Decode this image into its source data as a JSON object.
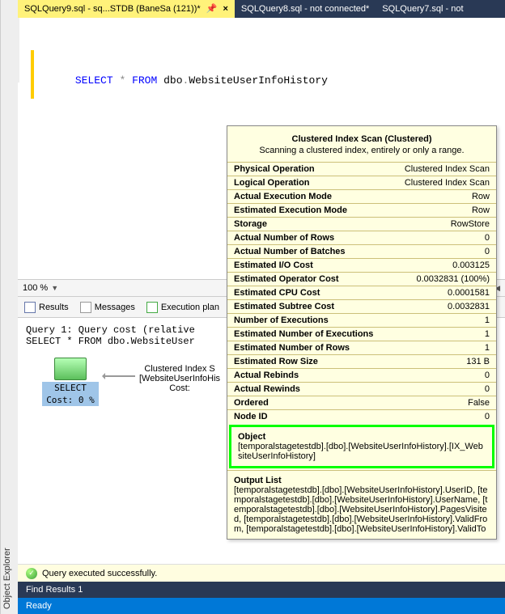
{
  "sidebar": {
    "label": "Object Explorer"
  },
  "tabs": [
    {
      "label": "SQLQuery9.sql - sq...STDB (BaneSa (121))*",
      "active": true,
      "pinned": true
    },
    {
      "label": "SQLQuery8.sql - not connected*",
      "active": false
    },
    {
      "label": "SQLQuery7.sql - not",
      "active": false
    }
  ],
  "editor": {
    "kw_select": "SELECT",
    "star": "*",
    "kw_from": "FROM",
    "schema": "dbo",
    "dot": ".",
    "table": "WebsiteUserInfoHistory"
  },
  "zoom": {
    "percent": "100 %"
  },
  "result_tabs": {
    "results": "Results",
    "messages": "Messages",
    "execplan": "Execution plan"
  },
  "query_lines": {
    "l1": "Query 1: Query cost (relative",
    "l2": "SELECT * FROM dbo.WebsiteUser"
  },
  "plan": {
    "select_label": "SELECT",
    "select_cost": "Cost: 0 %",
    "scan_l1": "Clustered Index S",
    "scan_l2": "[WebsiteUserInfoHis",
    "scan_l3": "Cost:"
  },
  "status": {
    "text": "Query executed successfully."
  },
  "find": {
    "label": "Find Results 1"
  },
  "ready": {
    "label": "Ready"
  },
  "tooltip": {
    "title": "Clustered Index Scan (Clustered)",
    "subtitle": "Scanning a clustered index, entirely or only a range.",
    "rows": [
      {
        "k": "Physical Operation",
        "v": "Clustered Index Scan"
      },
      {
        "k": "Logical Operation",
        "v": "Clustered Index Scan"
      },
      {
        "k": "Actual Execution Mode",
        "v": "Row"
      },
      {
        "k": "Estimated Execution Mode",
        "v": "Row"
      },
      {
        "k": "Storage",
        "v": "RowStore"
      },
      {
        "k": "Actual Number of Rows",
        "v": "0"
      },
      {
        "k": "Actual Number of Batches",
        "v": "0"
      },
      {
        "k": "Estimated I/O Cost",
        "v": "0.003125"
      },
      {
        "k": "Estimated Operator Cost",
        "v": "0.0032831 (100%)"
      },
      {
        "k": "Estimated CPU Cost",
        "v": "0.0001581"
      },
      {
        "k": "Estimated Subtree Cost",
        "v": "0.0032831"
      },
      {
        "k": "Number of Executions",
        "v": "1"
      },
      {
        "k": "Estimated Number of Executions",
        "v": "1"
      },
      {
        "k": "Estimated Number of Rows",
        "v": "1"
      },
      {
        "k": "Estimated Row Size",
        "v": "131 B"
      },
      {
        "k": "Actual Rebinds",
        "v": "0"
      },
      {
        "k": "Actual Rewinds",
        "v": "0"
      },
      {
        "k": "Ordered",
        "v": "False"
      },
      {
        "k": "Node ID",
        "v": "0"
      }
    ],
    "object": {
      "title": "Object",
      "value": "[temporalstagetestdb].[dbo].[WebsiteUserInfoHistory].[IX_WebsiteUserInfoHistory]"
    },
    "output": {
      "title": "Output List",
      "value": "[temporalstagetestdb].[dbo].[WebsiteUserInfoHistory].UserID, [temporalstagetestdb].[dbo].[WebsiteUserInfoHistory].UserName, [temporalstagetestdb].[dbo].[WebsiteUserInfoHistory].PagesVisited, [temporalstagetestdb].[dbo].[WebsiteUserInfoHistory].ValidFrom, [temporalstagetestdb].[dbo].[WebsiteUserInfoHistory].ValidTo"
    }
  }
}
